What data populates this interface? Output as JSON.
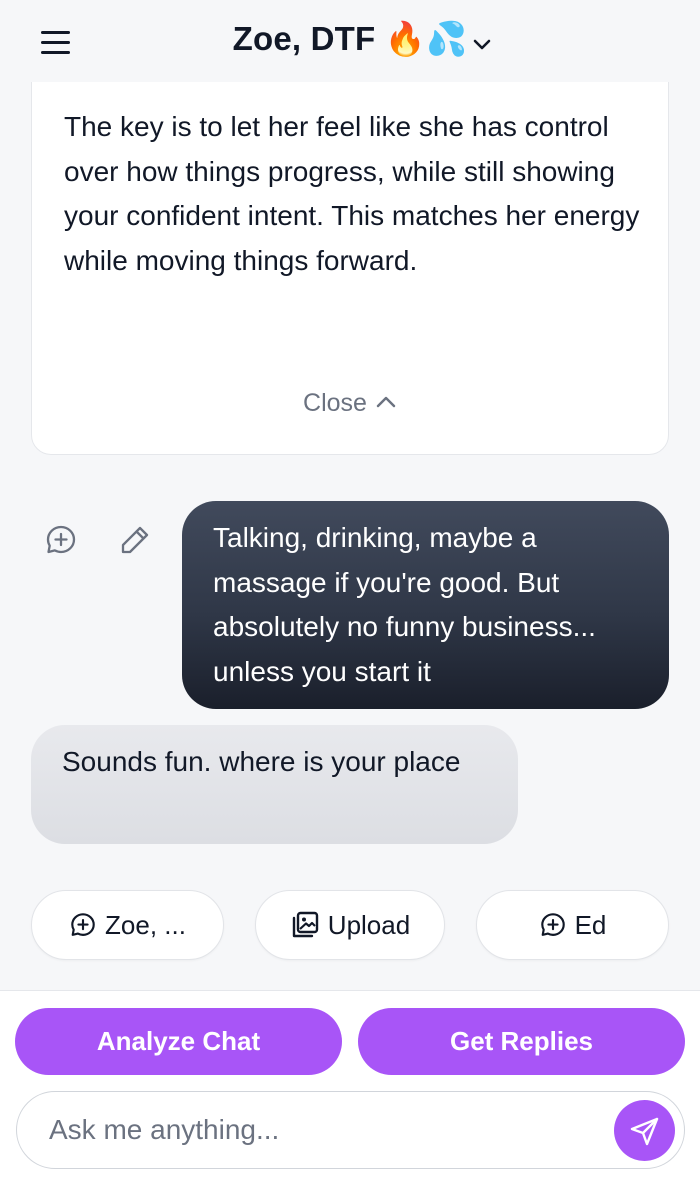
{
  "header": {
    "title": "Zoe, DTF 🔥💦",
    "menu_icon": "hamburger-menu-icon",
    "dropdown_icon": "chevron-down-icon"
  },
  "analysis_card": {
    "text": "The key is to let her feel like she has control over how things progress, while still showing your confident intent. This matches her energy while moving things forward.",
    "close_label": "Close",
    "close_icon": "chevron-up-icon"
  },
  "messages": [
    {
      "from": "user",
      "text": "Talking, drinking, maybe a massage if you're good. But absolutely no funny business... unless you start it",
      "actions": [
        "chat-plus-icon",
        "pencil-icon"
      ]
    },
    {
      "from": "match",
      "text": "Sounds fun. where is your place"
    }
  ],
  "chips": [
    {
      "label": "Zoe, ...",
      "icon": "chat-plus-icon"
    },
    {
      "label": "Upload",
      "icon": "image-upload-icon"
    },
    {
      "label": "Ed",
      "icon": "chat-plus-icon"
    }
  ],
  "actions": {
    "analyze_label": "Analyze Chat",
    "replies_label": "Get Replies"
  },
  "composer": {
    "placeholder": "Ask me anything...",
    "value": "",
    "send_icon": "send-icon"
  },
  "colors": {
    "accent": "#a855f7",
    "outgoing_bubble": "#2f3747",
    "incoming_bubble": "#e2e4e8",
    "background": "#f6f7f9"
  }
}
